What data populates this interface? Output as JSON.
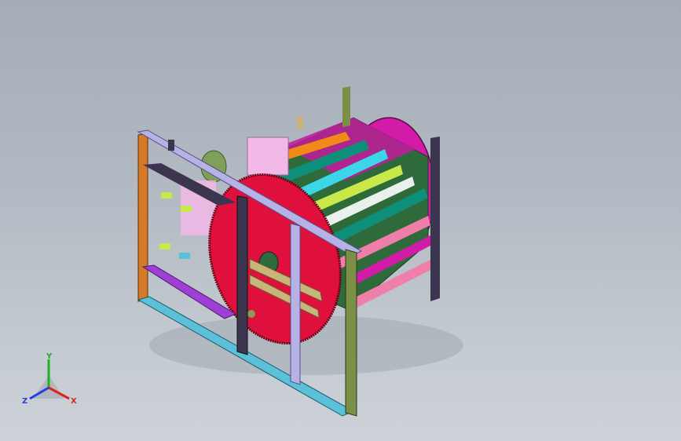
{
  "viewport": {
    "background_top": "#a4acb6",
    "background_bottom": "#cdd2d8"
  },
  "model": {
    "kind": "3d-cad-assembly",
    "colors": {
      "frame_orange": "#d67a2a",
      "frame_blue": "#8aa0e0",
      "frame_lavender": "#b7b2e6",
      "frame_purple": "#9f3fd6",
      "frame_cyan": "#5bc0d8",
      "frame_dark": "#3b3550",
      "frame_olive": "#7b8f46",
      "disk_red": "#e0103c",
      "drum_magenta": "#d21ca8",
      "drum_inner_green": "#2f6b3a",
      "slat_teal": "#0e8f7a",
      "slat_cyan": "#3cd6e8",
      "slat_orange": "#f28a1a",
      "slat_pink": "#ef7fa8",
      "slat_yellow": "#c9e84a",
      "motor_pink": "#f2b8e8",
      "motor_green": "#7f9f5a",
      "hub_khaki": "#c9b57a"
    }
  },
  "triad": {
    "x_label": "X",
    "y_label": "Y",
    "z_label": "Z",
    "x_color": "#e02020",
    "y_color": "#20b020",
    "z_color": "#2040e0"
  }
}
